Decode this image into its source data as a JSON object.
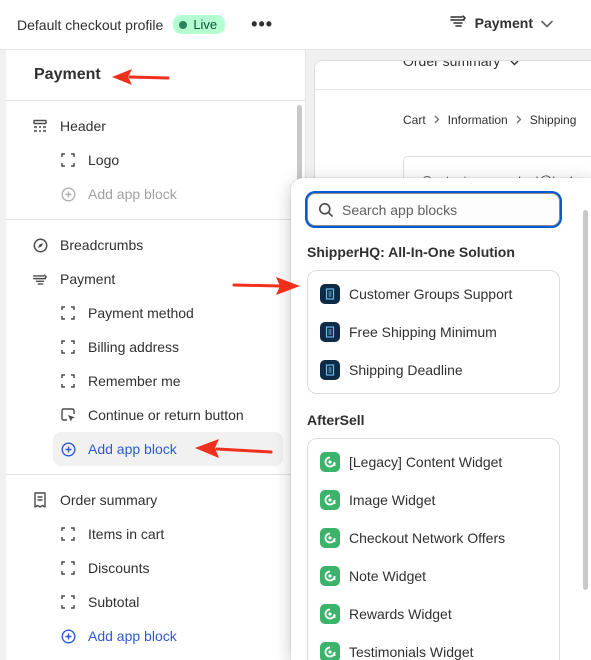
{
  "topbar": {
    "profile_name": "Default checkout profile",
    "status_badge": "Live",
    "more_label": "•••",
    "page_selector": "Payment"
  },
  "sidebar": {
    "title": "Payment",
    "sections": [
      {
        "items": [
          {
            "label": "Header",
            "icon": "header-layout-icon",
            "level": 1
          },
          {
            "label": "Logo",
            "icon": "block-dashed-icon",
            "level": 2
          },
          {
            "label": "Add app block",
            "icon": "plus-circle-icon",
            "level": 2,
            "style": "muted"
          }
        ]
      },
      {
        "items": [
          {
            "label": "Breadcrumbs",
            "icon": "compass-icon",
            "level": 1
          },
          {
            "label": "Payment",
            "icon": "payment-icon",
            "level": 1
          },
          {
            "label": "Payment method",
            "icon": "block-dashed-icon",
            "level": 2
          },
          {
            "label": "Billing address",
            "icon": "block-dashed-icon",
            "level": 2
          },
          {
            "label": "Remember me",
            "icon": "block-dashed-icon",
            "level": 2
          },
          {
            "label": "Continue or return button",
            "icon": "cursor-button-icon",
            "level": 2
          },
          {
            "label": "Add app block",
            "icon": "plus-circle-icon",
            "level": 2,
            "style": "blue-highlight"
          }
        ]
      },
      {
        "items": [
          {
            "label": "Order summary",
            "icon": "receipt-icon",
            "level": 1
          },
          {
            "label": "Items in cart",
            "icon": "block-dashed-icon",
            "level": 2
          },
          {
            "label": "Discounts",
            "icon": "block-dashed-icon",
            "level": 2
          },
          {
            "label": "Subtotal",
            "icon": "block-dashed-icon",
            "level": 2
          },
          {
            "label": "Add app block",
            "icon": "plus-circle-icon",
            "level": 2,
            "style": "blue"
          }
        ]
      }
    ]
  },
  "preview": {
    "order_summary": "Order summary",
    "breadcrumbs": [
      "Cart",
      "Information",
      "Shipping"
    ],
    "contact_label": "Contact",
    "contact_value": "test@test.c"
  },
  "popover": {
    "search_placeholder": "Search app blocks",
    "groups": [
      {
        "title": "ShipperHQ: All-In-One Solution",
        "icon": "shipperhq-app-icon",
        "items": [
          "Customer Groups Support",
          "Free Shipping Minimum",
          "Shipping Deadline"
        ]
      },
      {
        "title": "AfterSell",
        "icon": "aftersell-app-icon",
        "items": [
          "[Legacy] Content Widget",
          "Image Widget",
          "Checkout Network Offers",
          "Note Widget",
          "Rewards Widget",
          "Testimonials Widget"
        ]
      }
    ]
  },
  "colors": {
    "accent_blue": "#2c5bd1",
    "live_badge_bg": "#b4fed2",
    "live_badge_text": "#0c5132",
    "annotation_arrow": "#f0301c",
    "shipperhq_icon": "#0f2a44",
    "aftersell_icon": "#3cb36b"
  }
}
